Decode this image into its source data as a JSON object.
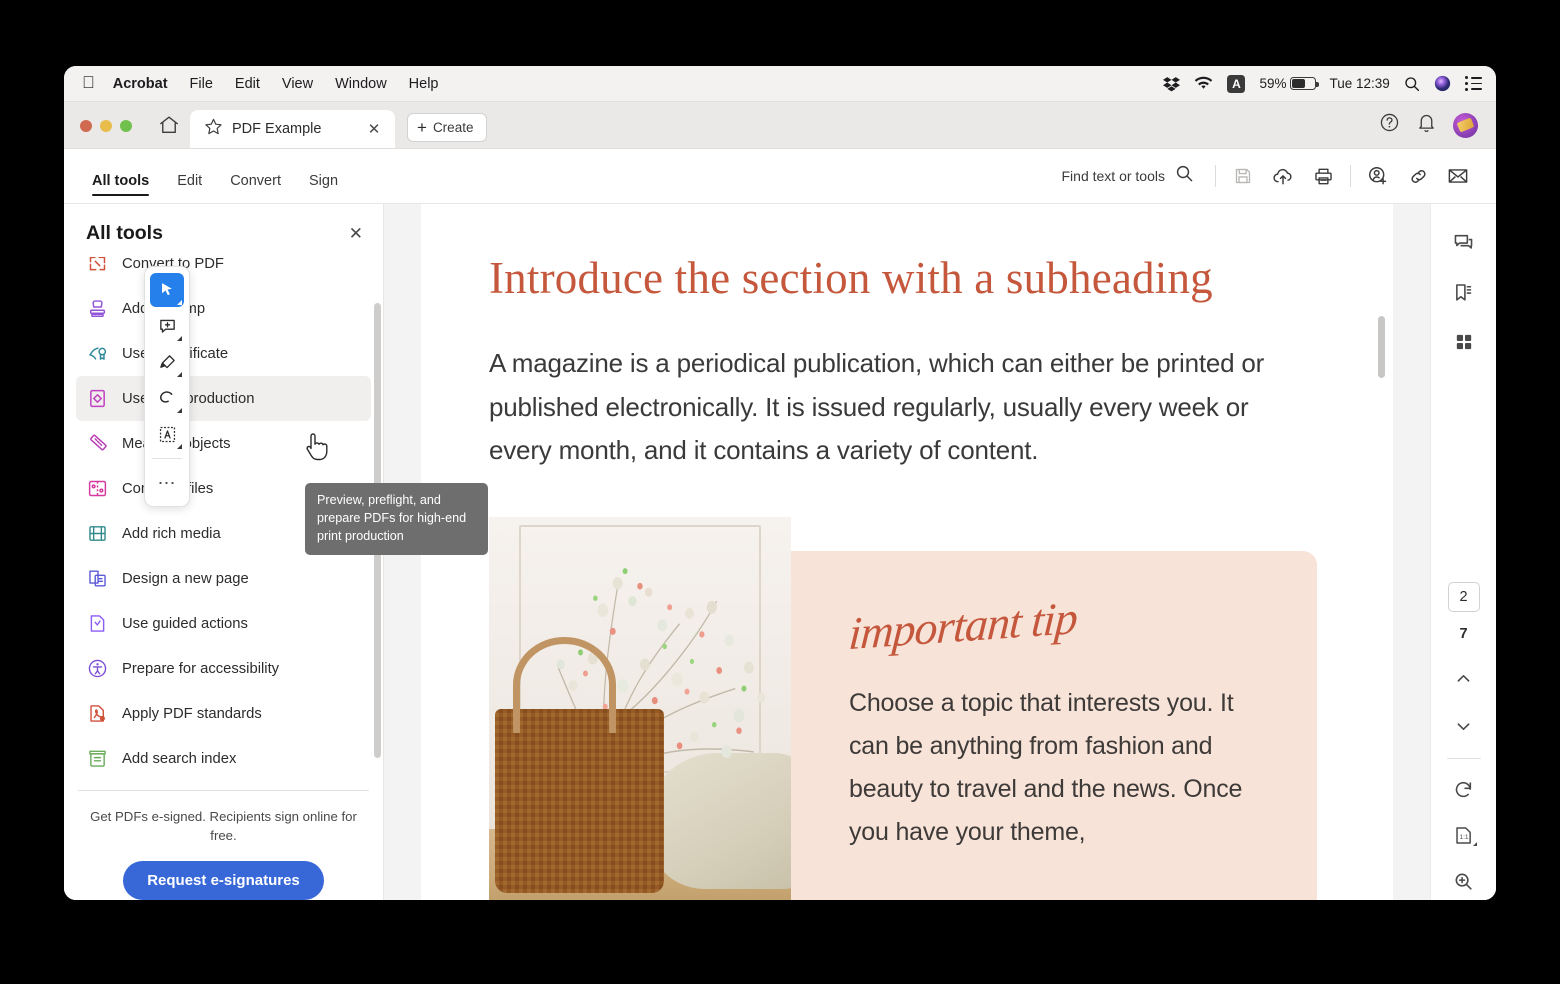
{
  "menubar": {
    "apple": "apple-logo",
    "app_name": "Acrobat",
    "items": [
      "File",
      "Edit",
      "View",
      "Window",
      "Help"
    ],
    "status": {
      "dropbox_icon": "dropbox-icon",
      "wifi_icon": "wifi-icon",
      "input_source": "A",
      "battery_percent": "59%",
      "clock": "Tue 12:39",
      "spotlight_icon": "search-icon",
      "siri_icon": "siri-icon",
      "control_center_icon": "control-center-icon"
    }
  },
  "tabbar": {
    "home_icon": "home-icon",
    "tab": {
      "star_icon": "star-icon",
      "title": "PDF Example",
      "close": "✕"
    },
    "create_label": "Create",
    "right_icons": {
      "help": "help-icon",
      "bell": "notification-bell-icon",
      "avatar": "user-avatar"
    }
  },
  "toolrow": {
    "tabs": [
      {
        "label": "All tools",
        "active": true
      },
      {
        "label": "Edit",
        "active": false
      },
      {
        "label": "Convert",
        "active": false
      },
      {
        "label": "Sign",
        "active": false
      }
    ],
    "find_label": "Find text or tools",
    "icons": [
      "search-icon",
      "save-icon",
      "cloud-upload-icon",
      "print-icon",
      "add-person-icon",
      "link-icon",
      "email-icon"
    ]
  },
  "sidebar": {
    "title": "All tools",
    "close": "✕",
    "tools": [
      {
        "label": "Convert to PDF",
        "icon": "convert-to-pdf-icon",
        "color": "#d1503a",
        "active": false
      },
      {
        "label": "Add a stamp",
        "icon": "stamp-icon",
        "color": "#9256d9",
        "active": false
      },
      {
        "label": "Use a certificate",
        "icon": "certificate-icon",
        "color": "#2f8a9b",
        "active": false
      },
      {
        "label": "Use print production",
        "icon": "print-production-icon",
        "color": "#c040c0",
        "active": true
      },
      {
        "label": "Measure objects",
        "icon": "ruler-icon",
        "color": "#b83fb8",
        "active": false
      },
      {
        "label": "Compare files",
        "icon": "compare-files-icon",
        "color": "#d63a9e",
        "active": false
      },
      {
        "label": "Add rich media",
        "icon": "film-icon",
        "color": "#2f8a8a",
        "active": false
      },
      {
        "label": "Design a new page",
        "icon": "design-page-icon",
        "color": "#5b5bd6",
        "active": false
      },
      {
        "label": "Use guided actions",
        "icon": "guided-actions-icon",
        "color": "#8b5cf6",
        "active": false
      },
      {
        "label": "Prepare for accessibility",
        "icon": "accessibility-icon",
        "color": "#7c4dd6",
        "active": false
      },
      {
        "label": "Apply PDF standards",
        "icon": "pdf-standards-icon",
        "color": "#d1503a",
        "active": false
      },
      {
        "label": "Add search index",
        "icon": "search-index-icon",
        "color": "#6aab5a",
        "active": false
      }
    ],
    "esign_text": "Get PDFs e-signed. Recipients sign online for free.",
    "esign_button": "Request e-signatures",
    "esign_button_color": "#3868d8"
  },
  "tooltip": {
    "text": "Preview, preflight, and prepare PDFs for high-end print production"
  },
  "floatbar": {
    "items": [
      {
        "name": "select-tool",
        "icon": "cursor-arrow-icon",
        "active": true
      },
      {
        "name": "comment-tool",
        "icon": "add-comment-icon",
        "active": false
      },
      {
        "name": "highlight-tool",
        "icon": "highlighter-icon",
        "active": false
      },
      {
        "name": "draw-tool",
        "icon": "lasso-draw-icon",
        "active": false
      },
      {
        "name": "edit-text-tool",
        "icon": "select-text-region-icon",
        "active": false
      }
    ],
    "more": "⋯"
  },
  "document": {
    "heading": "Introduce the section with a subheading",
    "body": "A magazine is a periodical publication, which can either be printed or published electronically. It is issued regularly, usually every week or every month, and it contains a variety of content.",
    "heading_color": "#c5583c",
    "photo_alt": "dried-flowers-in-wicker-basket-photo",
    "tip_title": "important tip",
    "tip_body": "Choose a topic that interests you. It can be anything from fashion and beauty to travel and the news. Once you have your theme,",
    "tip_bg": "#f7e3d8"
  },
  "rightrail": {
    "top_icons": [
      "comments-panel-icon",
      "bookmarks-panel-icon",
      "thumbnails-panel-icon"
    ],
    "page_current": "2",
    "page_total": "7",
    "up_icon": "chevron-up-icon",
    "down_icon": "chevron-down-icon",
    "bottom_icons": [
      "rotate-icon",
      "fit-page-icon",
      "zoom-in-icon",
      "zoom-out-icon"
    ]
  }
}
